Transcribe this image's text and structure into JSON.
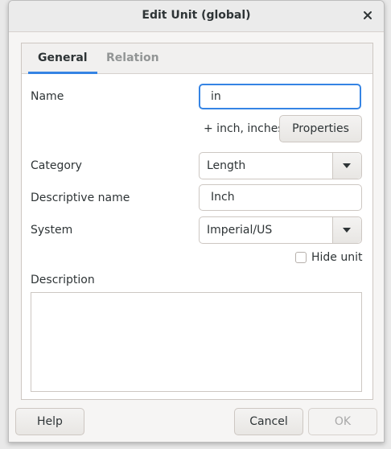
{
  "window": {
    "title": "Edit Unit (global)"
  },
  "tabs": [
    {
      "label": "General",
      "active": true
    },
    {
      "label": "Relation",
      "active": false
    }
  ],
  "form": {
    "name_label": "Name",
    "name_value": "in",
    "plural_hint": "+ inch, inches",
    "properties_button": "Properties",
    "category_label": "Category",
    "category_value": "Length",
    "descriptive_name_label": "Descriptive name",
    "descriptive_name_value": "Inch",
    "system_label": "System",
    "system_value": "Imperial/US",
    "hide_unit_label": "Hide unit",
    "hide_unit_checked": false,
    "description_label": "Description",
    "description_value": ""
  },
  "footer": {
    "help_button": "Help",
    "cancel_button": "Cancel",
    "ok_button": "OK",
    "ok_enabled": false
  },
  "colors": {
    "accent": "#3584e4",
    "background": "#f6f5f4"
  },
  "icons": {
    "close": "close-icon",
    "dropdown": "chevron-down-icon"
  }
}
